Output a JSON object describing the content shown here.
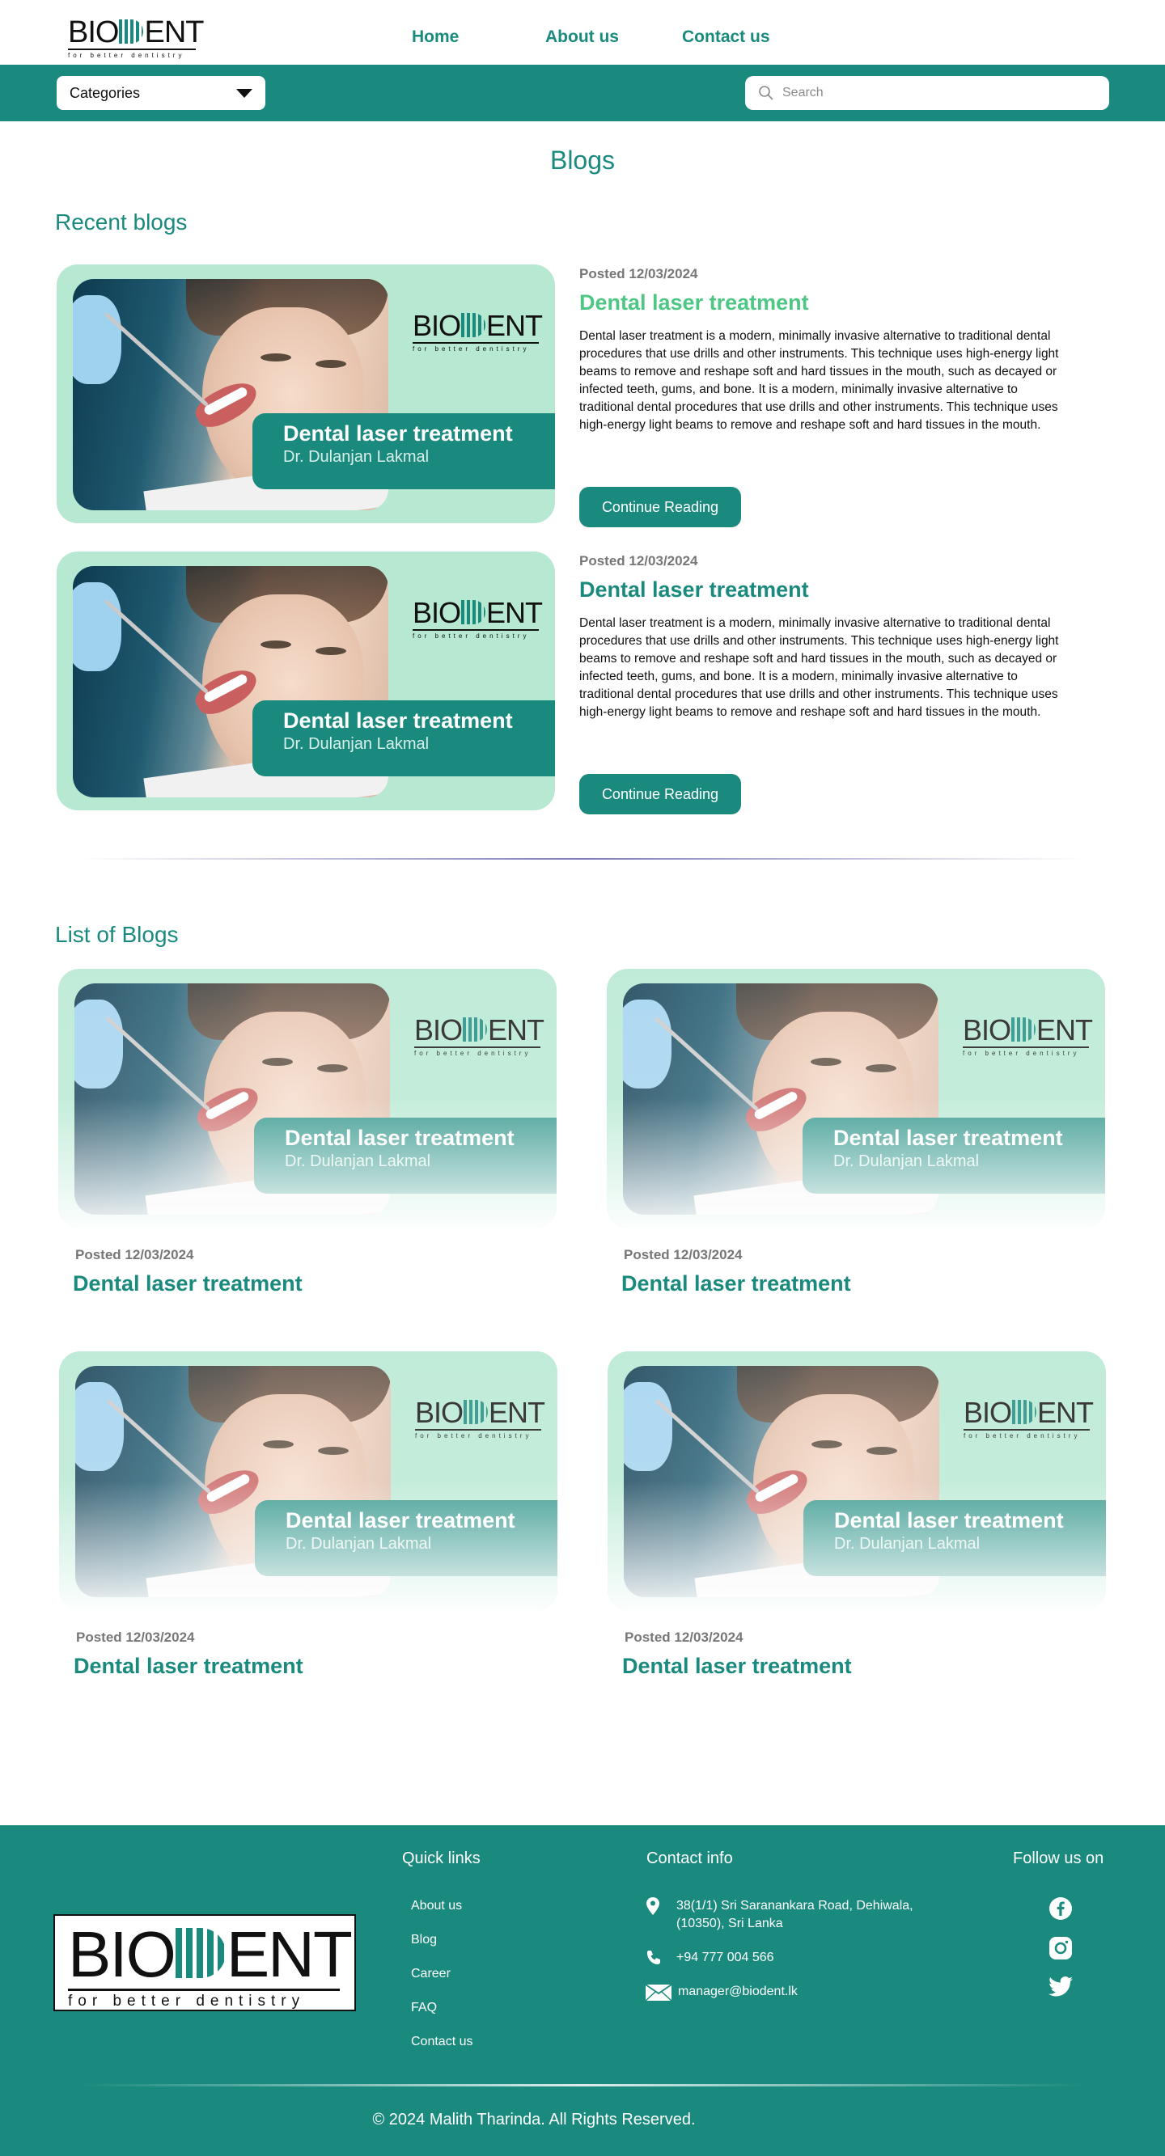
{
  "brand": {
    "name": "BIODENT",
    "tagline": "for better dentistry"
  },
  "nav": {
    "home": "Home",
    "about": "About us",
    "contact": "Contact us"
  },
  "toolbar": {
    "categories": "Categories",
    "search_placeholder": "Search"
  },
  "page": {
    "title": "Blogs",
    "recent_title": "Recent blogs",
    "list_title": "List of Blogs"
  },
  "banner": {
    "title": "Dental laser treatment",
    "author": "Dr. Dulanjan Lakmal"
  },
  "recent": [
    {
      "posted": "Posted 12/03/2024",
      "title": "Dental laser treatment",
      "desc": "Dental laser treatment is a modern, minimally invasive alternative to traditional dental procedures that use drills and other instruments. This technique uses high-energy light beams to remove and reshape soft and hard tissues in the mouth, such as decayed or infected teeth, gums, and bone. It is a modern, minimally invasive alternative to traditional dental procedures that use drills and other instruments. This technique uses high-energy light beams to remove and reshape soft and hard tissues in the mouth.",
      "button": "Continue Reading"
    },
    {
      "posted": "Posted 12/03/2024",
      "title": "Dental laser treatment",
      "desc": "Dental laser treatment is a modern, minimally invasive alternative to traditional dental procedures that use drills and other instruments. This technique uses high-energy light beams to remove and reshape soft and hard tissues in the mouth, such as decayed or infected teeth, gums, and bone. It is a modern, minimally invasive alternative to traditional dental procedures that use drills and other instruments. This technique uses high-energy light beams to remove and reshape soft and hard tissues in the mouth.",
      "button": "Continue Reading"
    }
  ],
  "list": [
    {
      "posted": "Posted 12/03/2024",
      "title": "Dental laser treatment"
    },
    {
      "posted": "Posted 12/03/2024",
      "title": "Dental laser treatment"
    },
    {
      "posted": "Posted 12/03/2024",
      "title": "Dental laser treatment"
    },
    {
      "posted": "Posted 12/03/2024",
      "title": "Dental laser treatment"
    }
  ],
  "footer": {
    "quick_links_title": "Quick links",
    "links": [
      "About us",
      "Blog",
      "Career",
      "FAQ",
      "Contact us"
    ],
    "contact_title": "Contact info",
    "address": "38(1/1) Sri Saranankara Road, Dehiwala, (10350), Sri Lanka",
    "phone": "+94 777 004 566",
    "email": "manager@biodent.lk",
    "follow_title": "Follow us on",
    "social": [
      "facebook-icon",
      "instagram-icon",
      "twitter-icon"
    ],
    "copyright": "© 2024 Malith Tharinda. All Rights Reserved."
  },
  "colors": {
    "primary": "#1a8a7e",
    "banner_bg": "#b6e8d2",
    "title_light": "#4ec785"
  }
}
